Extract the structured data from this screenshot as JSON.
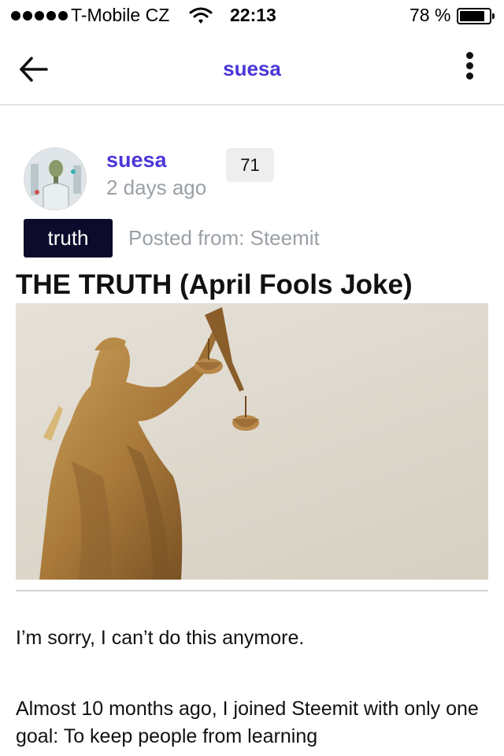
{
  "status_bar": {
    "carrier": "T-Mobile CZ",
    "time": "22:13",
    "battery_percent": "78 %",
    "battery_level": 0.78
  },
  "header": {
    "title": "suesa"
  },
  "post": {
    "author": "suesa",
    "age": "2 days ago",
    "score": "71",
    "tag": "truth",
    "posted_from": "Posted from: Steemit",
    "title": "THE TRUTH (April Fools Joke)",
    "paragraphs": [
      "I’m sorry, I can’t do this anymore.",
      "Almost 10 months ago, I joined Steemit with only one goal: To keep people from learning"
    ]
  },
  "colors": {
    "accent": "#4a36d8",
    "tag_background": "#0d0b2b",
    "muted_text": "#9aa0a6"
  },
  "icons": {
    "back": "arrow-left-icon",
    "more": "more-vertical-icon",
    "wifi": "wifi-icon",
    "battery": "battery-icon"
  }
}
